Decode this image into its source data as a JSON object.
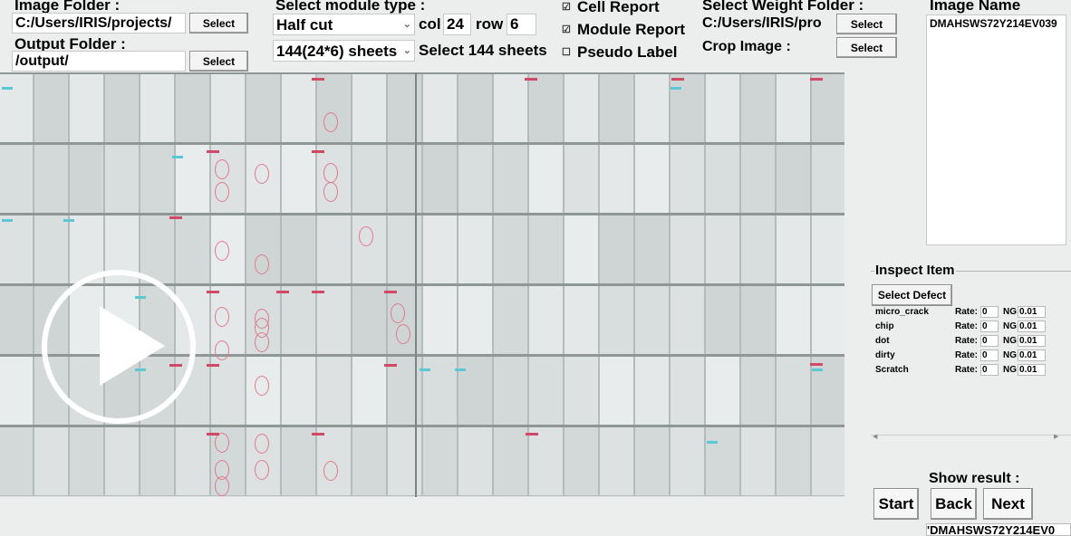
{
  "image_folder": {
    "label": "Image Folder :",
    "value": "C:/Users/IRIS/projects/",
    "button": "Select"
  },
  "output_folder": {
    "label": "Output Folder :",
    "value": "/output/",
    "button": "Select"
  },
  "module_type": {
    "label": "Select module type :",
    "selected": "Half cut",
    "col_label": "col",
    "col_value": "24",
    "row_label": "row",
    "row_value": "6",
    "sheets_selected": "144(24*6) sheets",
    "sheets_text": "Select 144 sheets"
  },
  "reports": {
    "cell_report": {
      "label": "Cell Report",
      "checked": true
    },
    "module_report": {
      "label": "Module Report",
      "checked": true
    },
    "pseudo_label": {
      "label": "Pseudo Label",
      "checked": false
    }
  },
  "weight_folder": {
    "label": "Select Weight Folder :",
    "value": "C:/Users/IRIS/pro",
    "button": "Select"
  },
  "crop_image": {
    "label": "Crop Image :",
    "button": "Select"
  },
  "image_name": {
    "label": "Image Name",
    "items": [
      "DMAHSWS72Y214EV039"
    ]
  },
  "inspect": {
    "title": "Inspect Item",
    "select_defect_button": "Select Defect",
    "rate_label": "Rate:",
    "ng_label": "NG:",
    "defects": [
      {
        "name": "micro_crack",
        "rate": "0",
        "ng": "0.01"
      },
      {
        "name": "chip",
        "rate": "0",
        "ng": "0.01"
      },
      {
        "name": "dot",
        "rate": "0",
        "ng": "0.01"
      },
      {
        "name": "dirty",
        "rate": "0",
        "ng": "0.01"
      },
      {
        "name": "Scratch",
        "rate": "0",
        "ng": "0.01"
      }
    ]
  },
  "result": {
    "label": "Show result :",
    "start": "Start",
    "back": "Back",
    "next": "Next",
    "current": "'DMAHSWS72Y214EV0"
  },
  "icons": {
    "play": "play-icon",
    "checked": "checkbox-checked-icon",
    "unchecked": "checkbox-unchecked-icon",
    "dropdown": "chevron-down-icon"
  },
  "colors": {
    "background": "#eceeee",
    "panel": "#dfe3e3",
    "defect_mark": "#d04a66",
    "defect_circle": "#e07a8c"
  }
}
